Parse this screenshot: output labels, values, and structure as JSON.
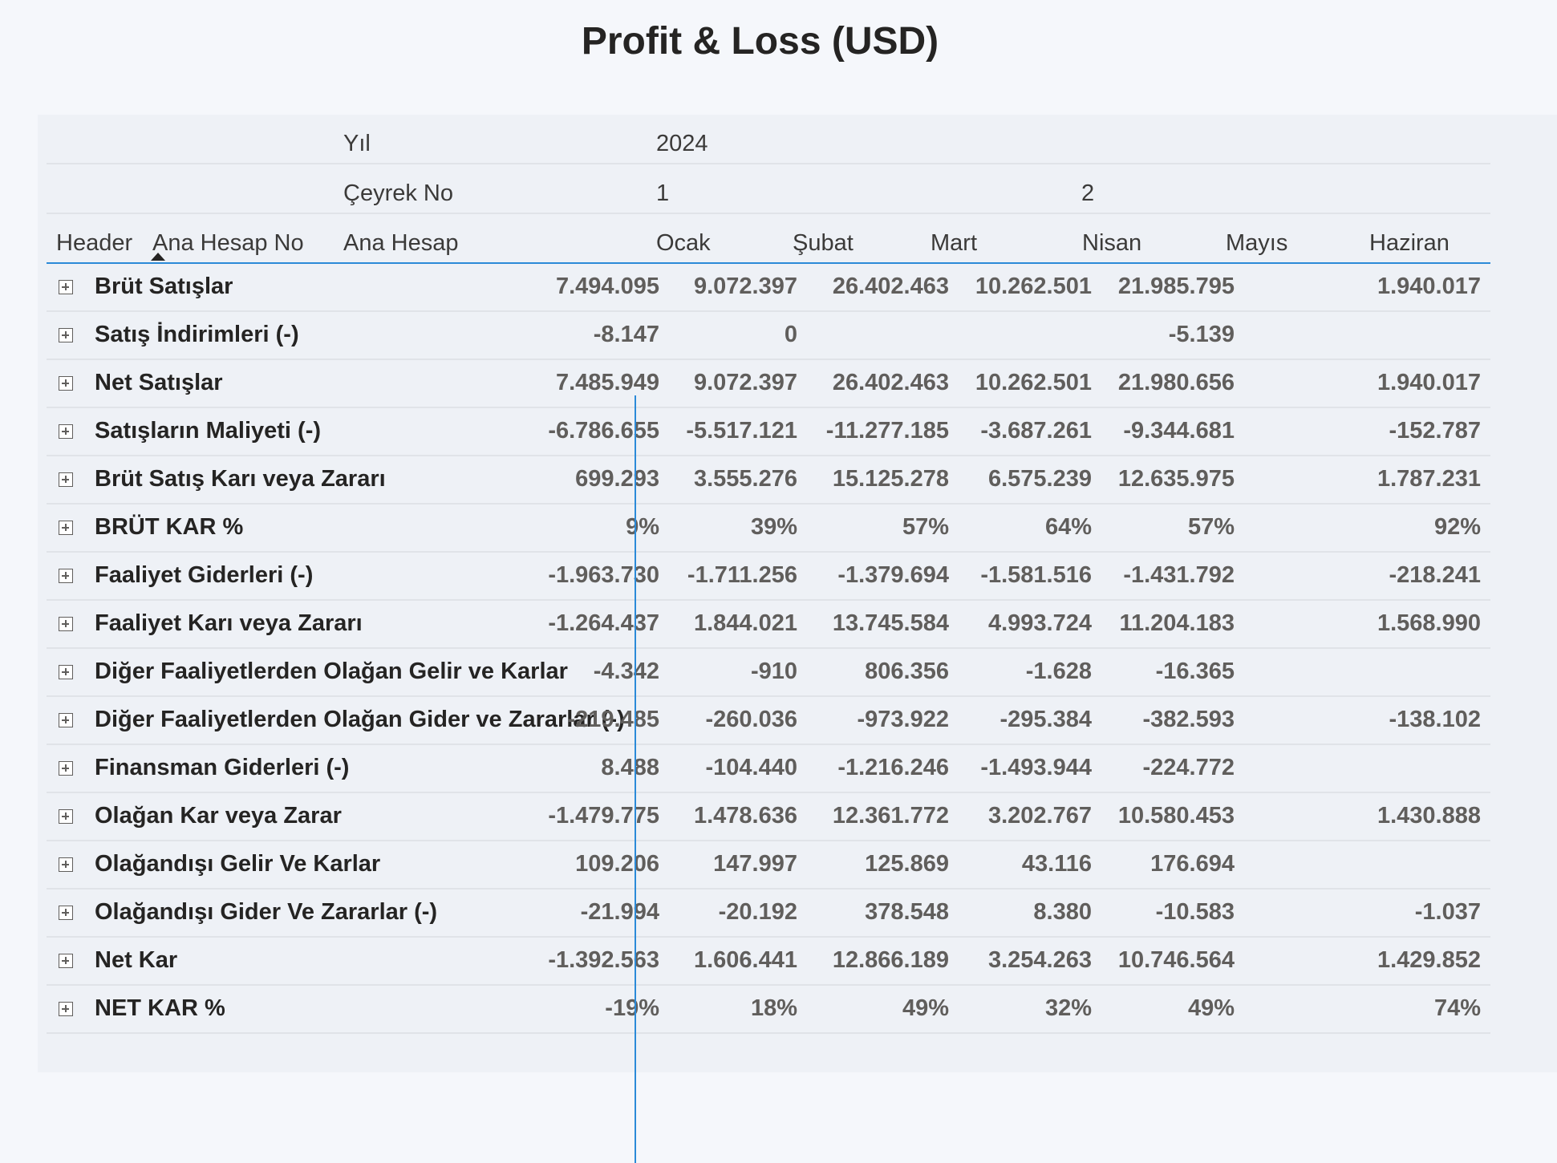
{
  "title": "Profit & Loss (USD)",
  "header": {
    "year_label": "Yıl",
    "year_value": "2024",
    "quarter_label": "Çeyrek No",
    "quarter_1": "1",
    "quarter_2": "2",
    "col_header": "Header",
    "col_ana_hesap_no": "Ana Hesap No",
    "col_ana_hesap": "Ana Hesap",
    "months": [
      "Ocak",
      "Şubat",
      "Mart",
      "Nisan",
      "Mayıs",
      "Haziran"
    ]
  },
  "rows": [
    {
      "label": "Brüt Satışlar",
      "values": [
        "7.494.095",
        "9.072.397",
        "26.402.463",
        "10.262.501",
        "21.985.795",
        "1.940.017"
      ]
    },
    {
      "label": "Satış İndirimleri (-)",
      "values": [
        "-8.147",
        "0",
        "",
        "",
        "-5.139",
        ""
      ]
    },
    {
      "label": "Net Satışlar",
      "values": [
        "7.485.949",
        "9.072.397",
        "26.402.463",
        "10.262.501",
        "21.980.656",
        "1.940.017"
      ]
    },
    {
      "label": "Satışların Maliyeti (-)",
      "values": [
        "-6.786.655",
        "-5.517.121",
        "-11.277.185",
        "-3.687.261",
        "-9.344.681",
        "-152.787"
      ]
    },
    {
      "label": "Brüt Satış Karı veya Zararı",
      "values": [
        "699.293",
        "3.555.276",
        "15.125.278",
        "6.575.239",
        "12.635.975",
        "1.787.231"
      ]
    },
    {
      "label": "BRÜT KAR %",
      "values": [
        "9%",
        "39%",
        "57%",
        "64%",
        "57%",
        "92%"
      ]
    },
    {
      "label": "Faaliyet Giderleri (-)",
      "values": [
        "-1.963.730",
        "-1.711.256",
        "-1.379.694",
        "-1.581.516",
        "-1.431.792",
        "-218.241"
      ]
    },
    {
      "label": "Faaliyet Karı veya Zararı",
      "values": [
        "-1.264.437",
        "1.844.021",
        "13.745.584",
        "4.993.724",
        "11.204.183",
        "1.568.990"
      ]
    },
    {
      "label": "Diğer Faaliyetlerden Olağan Gelir ve Karlar",
      "values": [
        "-4.342",
        "-910",
        "806.356",
        "-1.628",
        "-16.365",
        ""
      ]
    },
    {
      "label": "Diğer Faaliyetlerden Olağan Gider ve Zararlar (-)",
      "values": [
        "-219.485",
        "-260.036",
        "-973.922",
        "-295.384",
        "-382.593",
        "-138.102"
      ]
    },
    {
      "label": "Finansman Giderleri (-)",
      "values": [
        "8.488",
        "-104.440",
        "-1.216.246",
        "-1.493.944",
        "-224.772",
        ""
      ]
    },
    {
      "label": "Olağan Kar veya Zarar",
      "values": [
        "-1.479.775",
        "1.478.636",
        "12.361.772",
        "3.202.767",
        "10.580.453",
        "1.430.888"
      ]
    },
    {
      "label": "Olağandışı Gelir Ve Karlar",
      "values": [
        "109.206",
        "147.997",
        "125.869",
        "43.116",
        "176.694",
        ""
      ]
    },
    {
      "label": "Olağandışı Gider Ve Zararlar (-)",
      "values": [
        "-21.994",
        "-20.192",
        "378.548",
        "8.380",
        "-10.583",
        "-1.037"
      ]
    },
    {
      "label": "Net Kar",
      "values": [
        "-1.392.563",
        "1.606.441",
        "12.866.189",
        "3.254.263",
        "10.746.564",
        "1.429.852"
      ]
    },
    {
      "label": "NET KAR %",
      "values": [
        "-19%",
        "18%",
        "49%",
        "32%",
        "49%",
        "74%"
      ]
    }
  ],
  "colors": {
    "accent": "#2b8ad8",
    "value_text": "#605e5c",
    "label_text": "#252423"
  }
}
